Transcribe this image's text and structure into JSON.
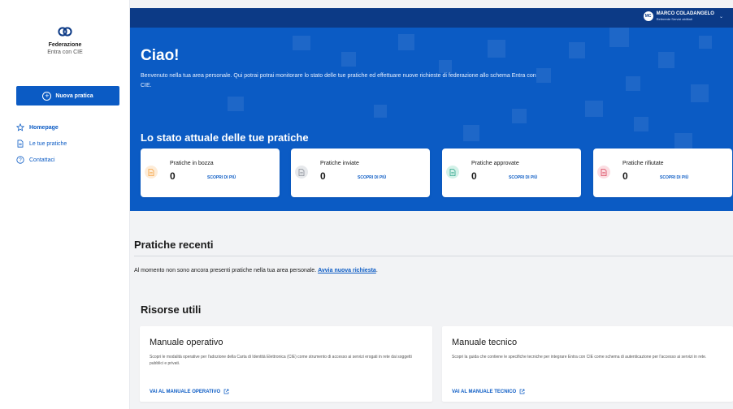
{
  "sidebar": {
    "logo_title": "Federazione",
    "logo_subtitle": "Entra con CIE",
    "new_button_label": "Nuova pratica",
    "nav": [
      {
        "label": "Homepage"
      },
      {
        "label": "Le tue pratiche"
      },
      {
        "label": "Contattaci"
      }
    ]
  },
  "topbar": {
    "user_initials": "MC",
    "user_name": "MARCO COLADANGELO",
    "user_role": "Referente Servizi abilitati"
  },
  "hero": {
    "title": "Ciao!",
    "text": "Benvenuto nella tua area personale. Qui potrai potrai monitorare lo stato delle tue pratiche ed effettuare nuove richieste di federazione allo schema Entra con CIE.",
    "status_title": "Lo stato attuale delle tue pratiche"
  },
  "cards": [
    {
      "title": "Pratiche in bozza",
      "count": "0",
      "more": "SCOPRI DI PIÙ",
      "color": "#f6a03c",
      "bg": "#fdecd8"
    },
    {
      "title": "Pratiche inviate",
      "count": "0",
      "more": "SCOPRI DI PIÙ",
      "color": "#8a8f98",
      "bg": "#e6e8eb"
    },
    {
      "title": "Pratiche approvate",
      "count": "0",
      "more": "SCOPRI DI PIÙ",
      "color": "#2ea58b",
      "bg": "#d3f1e8"
    },
    {
      "title": "Pratiche rifiutate",
      "count": "0",
      "more": "SCOPRI DI PIÙ",
      "color": "#d9435a",
      "bg": "#fbdde2"
    }
  ],
  "recent": {
    "title": "Pratiche recenti",
    "text": "Al momento non sono ancora presenti pratiche nella tua area personale.",
    "link": "Avvia nuova richiesta"
  },
  "resources": {
    "title": "Risorse utili",
    "items": [
      {
        "title": "Manuale operativo",
        "desc": "Scopri le modalità operative per l'adozione della Carta di Identità Elettronica (CIE) come strumento di accesso ai servizi erogati in rete dai soggetti pubblici e privati.",
        "link": "VAI AL MANUALE OPERATIVO"
      },
      {
        "title": "Manuale tecnico",
        "desc": "Scopri la guida che contiene le specifiche tecniche per integrare Entra con CIE come schema di autenticazione per l'accesso ai servizi in rete.",
        "link": "VAI AL MANUALE TECNICO"
      }
    ]
  },
  "colors": {
    "primary": "#0b5bc4",
    "topbar": "#0c3a86"
  }
}
